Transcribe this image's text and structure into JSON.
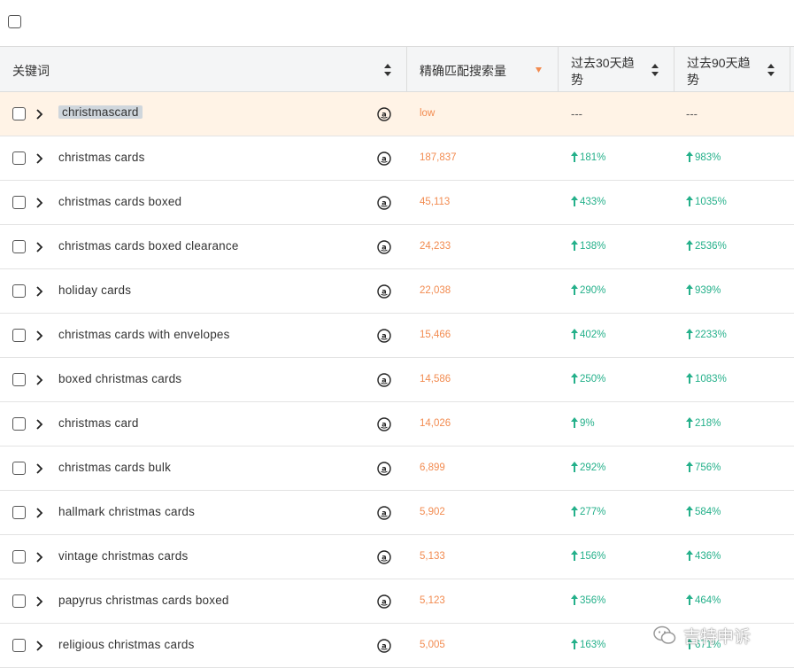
{
  "header": {
    "keyword_label": "关键词",
    "volume_label": "精确匹配搜索量",
    "trend30_label_1": "过去30天趋",
    "trend30_label_2": "势",
    "trend90_label_1": "过去90天趋",
    "trend90_label_2": "势"
  },
  "colors": {
    "volume": "#f28b50",
    "trend_up": "#24b08a",
    "highlight_row": "#fff3e6"
  },
  "rows": [
    {
      "keyword": "christmascard",
      "volume": "low",
      "trend30": "---",
      "trend90": "---"
    },
    {
      "keyword": "christmas cards",
      "volume": "187,837",
      "trend30": "181%",
      "trend90": "983%"
    },
    {
      "keyword": "christmas cards boxed",
      "volume": "45,113",
      "trend30": "433%",
      "trend90": "1035%"
    },
    {
      "keyword": "christmas cards boxed clearance",
      "volume": "24,233",
      "trend30": "138%",
      "trend90": "2536%"
    },
    {
      "keyword": "holiday cards",
      "volume": "22,038",
      "trend30": "290%",
      "trend90": "939%"
    },
    {
      "keyword": "christmas cards with envelopes",
      "volume": "15,466",
      "trend30": "402%",
      "trend90": "2233%"
    },
    {
      "keyword": "boxed christmas cards",
      "volume": "14,586",
      "trend30": "250%",
      "trend90": "1083%"
    },
    {
      "keyword": "christmas card",
      "volume": "14,026",
      "trend30": "9%",
      "trend90": "218%"
    },
    {
      "keyword": "christmas cards bulk",
      "volume": "6,899",
      "trend30": "292%",
      "trend90": "756%"
    },
    {
      "keyword": "hallmark christmas cards",
      "volume": "5,902",
      "trend30": "277%",
      "trend90": "584%"
    },
    {
      "keyword": "vintage christmas cards",
      "volume": "5,133",
      "trend30": "156%",
      "trend90": "436%"
    },
    {
      "keyword": "papyrus christmas cards boxed",
      "volume": "5,123",
      "trend30": "356%",
      "trend90": "464%"
    },
    {
      "keyword": "religious christmas cards",
      "volume": "5,005",
      "trend30": "163%",
      "trend90": "671%"
    }
  ],
  "watermark": {
    "text": "吉特申诉",
    "icon": "wechat-icon"
  }
}
